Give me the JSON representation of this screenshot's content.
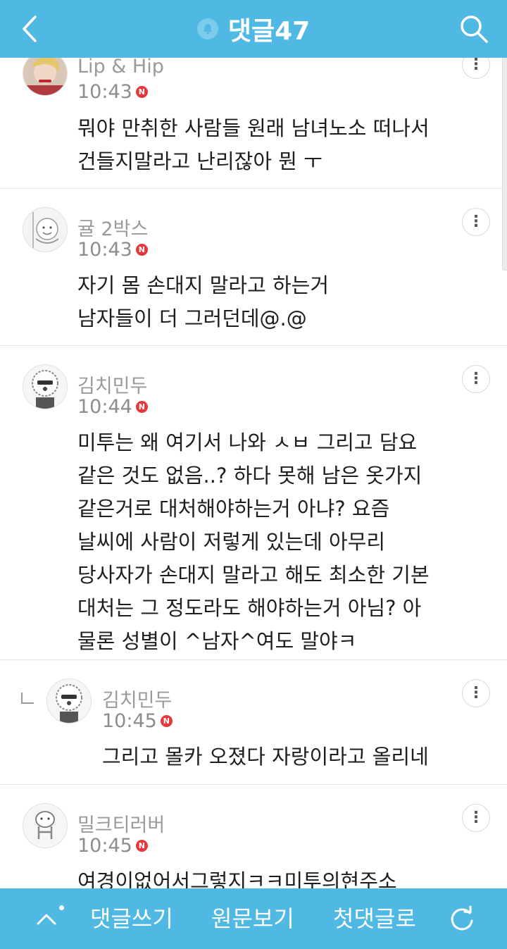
{
  "header": {
    "title": "댓글47",
    "bg_color": "#4fb9e3",
    "back_icon": "chevron-left-icon",
    "bell_icon": "bell-icon",
    "search_icon": "search-icon"
  },
  "comments": [
    {
      "author": "Lip & Hip",
      "time": "10:43",
      "badge": "N",
      "lines": [
        "뭐야 만취한 사람들 원래 남녀노소 떠나서",
        "건들지말라고 난리잖아 뭔 ㅜ"
      ],
      "is_reply": false
    },
    {
      "author": "귤 2박스",
      "time": "10:43",
      "badge": "N",
      "lines": [
        "자기 몸 손대지 말라고 하는거",
        "남자들이 더 그러던데@.@"
      ],
      "is_reply": false
    },
    {
      "author": "김치민두",
      "time": "10:44",
      "badge": "N",
      "lines": [
        "미투는 왜 여기서 나와 ㅅㅂ 그리고 담요",
        "같은 것도 없음..? 하다 못해 남은 옷가지",
        "같은거로 대처해야하는거 아냐? 요즘",
        "날씨에 사람이 저렇게 있는데 아무리",
        "당사자가 손대지 말라고 해도 최소한 기본",
        "대처는 그 정도라도 해야하는거 아님? 아",
        "물론 성별이 ^남자^여도 말야ㅋ"
      ],
      "is_reply": false
    },
    {
      "author": "김치민두",
      "time": "10:45",
      "badge": "N",
      "lines": [
        "그리고 몰카 오졌다 자랑이라고 올리네"
      ],
      "is_reply": true
    },
    {
      "author": "밀크티러버",
      "time": "10:45",
      "badge": "N",
      "lines": [
        "여경이없어서그렇지ㅋㅋ미투의현주소"
      ],
      "is_reply": false
    }
  ],
  "more_label": "⋮",
  "bottom_bar": {
    "up_icon": "chevron-up-icon",
    "write": "댓글쓰기",
    "original": "원문보기",
    "first": "첫댓글로",
    "refresh_icon": "refresh-icon"
  }
}
